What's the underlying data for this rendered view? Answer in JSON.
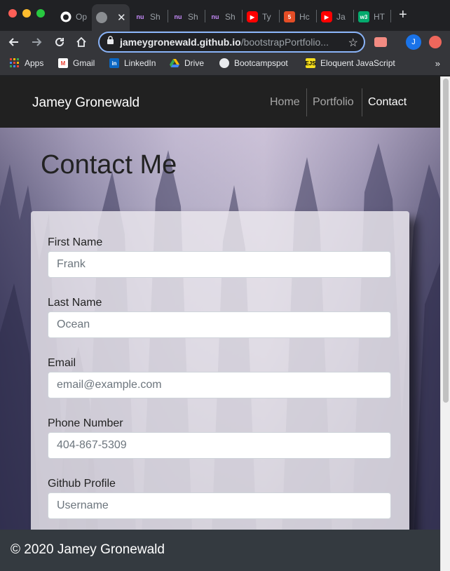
{
  "browser": {
    "tabs": [
      {
        "icon": "github-icon",
        "label": "Op"
      },
      {
        "icon": "globe-icon",
        "label": ""
      },
      {
        "icon": "nu-icon",
        "label": "Sh"
      },
      {
        "icon": "nu-icon",
        "label": "Sh"
      },
      {
        "icon": "nu-icon",
        "label": "Sh"
      },
      {
        "icon": "youtube-icon",
        "label": "Ty"
      },
      {
        "icon": "html5-icon",
        "label": "Hc"
      },
      {
        "icon": "youtube-icon",
        "label": "Ja"
      },
      {
        "icon": "w3schools-icon",
        "label": "HT"
      }
    ],
    "url_host": "jameygronewald.github.io",
    "url_path": "/bootstrapPortfolio...",
    "profile_initial": "J",
    "bookmarks": [
      {
        "icon": "apps-icon",
        "label": "Apps"
      },
      {
        "icon": "gmail-icon",
        "label": "Gmail"
      },
      {
        "icon": "linkedin-icon",
        "label": "LinkedIn"
      },
      {
        "icon": "drive-icon",
        "label": "Drive"
      },
      {
        "icon": "globe-icon",
        "label": "Bootcampspot"
      },
      {
        "icon": "ejs-icon",
        "label": "Eloquent JavaScript"
      }
    ],
    "bookmarks_more": "»"
  },
  "navbar": {
    "brand": "Jamey Gronewald",
    "links": [
      "Home",
      "Portfolio",
      "Contact"
    ],
    "active": "Contact"
  },
  "page": {
    "title": "Contact Me"
  },
  "form": {
    "fields": [
      {
        "label": "First Name",
        "placeholder": "Frank"
      },
      {
        "label": "Last Name",
        "placeholder": "Ocean"
      },
      {
        "label": "Email",
        "placeholder": "email@example.com"
      },
      {
        "label": "Phone Number",
        "placeholder": "404-867-5309"
      },
      {
        "label": "Github Profile",
        "placeholder": "Username"
      }
    ]
  },
  "footer": {
    "text": "© 2020 Jamey Gronewald"
  },
  "colors": {
    "navbar_bg": "#212121",
    "footer_bg": "#343a40",
    "omnibox_focus": "#8ab4f8"
  }
}
